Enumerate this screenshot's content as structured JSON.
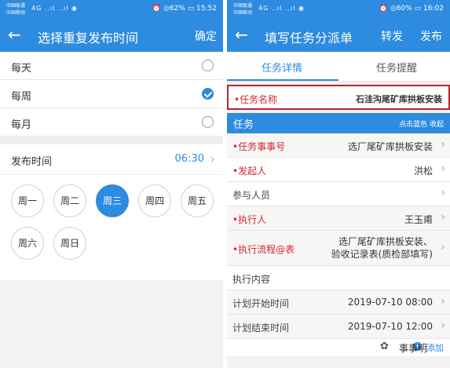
{
  "left": {
    "status": {
      "carrier1": "中国联通",
      "carrier2": "中国移动",
      "net": "4G ..ıl ..ıl ◉",
      "right": "⏰ ◎62% ▭ 15:52"
    },
    "nav": {
      "title": "选择重复发布时间",
      "confirm": "确定"
    },
    "options": [
      {
        "label": "每天",
        "checked": false
      },
      {
        "label": "每周",
        "checked": true
      },
      {
        "label": "每月",
        "checked": false
      }
    ],
    "publish_time": {
      "label": "发布时间",
      "value": "06:30"
    },
    "days": [
      {
        "label": "周一",
        "active": false
      },
      {
        "label": "周二",
        "active": false
      },
      {
        "label": "周三",
        "active": true
      },
      {
        "label": "周四",
        "active": false
      },
      {
        "label": "周五",
        "active": false
      },
      {
        "label": "周六",
        "active": false
      },
      {
        "label": "周日",
        "active": false
      }
    ]
  },
  "right": {
    "status": {
      "carrier1": "中国联通",
      "carrier2": "中国移动",
      "net": "4G ..ıl ..ıl ◉",
      "right": "⏰ ◎60% ▭ 16:02"
    },
    "nav": {
      "title": "填写任务分派单",
      "forward": "转发",
      "publish": "发布"
    },
    "tabs": [
      {
        "label": "任务详情",
        "active": true
      },
      {
        "label": "任务提醒",
        "active": false
      }
    ],
    "task_name": {
      "label": "任务名称",
      "value": "石洼沟尾矿库拱板安装"
    },
    "section": {
      "title": "任务",
      "hint": "点击蓝色 收起"
    },
    "rows": [
      {
        "label": "任务事事号",
        "value": "选厂尾矿库拱板安装",
        "required": true
      },
      {
        "label": "发起人",
        "value": "洪松",
        "required": true
      },
      {
        "label": "参与人员",
        "value": "",
        "required": false
      },
      {
        "label": "执行人",
        "value": "王玉甫",
        "required": true
      },
      {
        "label": "执行流程@表",
        "value_line1": "选厂尾矿库拱板安装、",
        "value_line2": "验收记录表(质检部填写)",
        "required": true
      },
      {
        "label": "执行内容",
        "value": "",
        "required": false
      },
      {
        "label": "计划开始时间",
        "value": "2019-07-10 08:00",
        "required": false
      },
      {
        "label": "计划结束时间",
        "value": "2019-07-10 12:00",
        "required": false
      }
    ],
    "add": {
      "label": "添加"
    }
  },
  "watermark": {
    "text": "事事明"
  },
  "colors": {
    "primary": "#2d8be0",
    "required": "#d9252c",
    "highlight_border": "#b4252c"
  }
}
